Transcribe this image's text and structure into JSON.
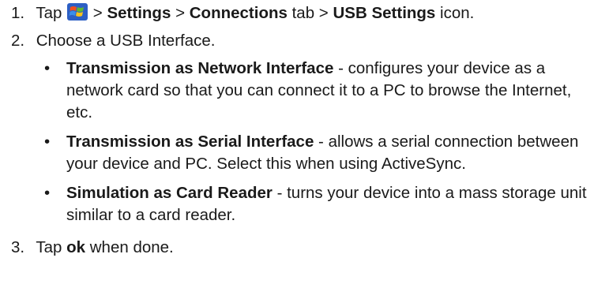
{
  "steps": [
    {
      "number": "1.",
      "text_tap": "Tap",
      "icon": "windows-start-icon",
      "sep1": ">",
      "settings": "Settings",
      "sep2": ">",
      "connections": "Connections",
      "text_tab": "tab >",
      "usb_settings": "USB Settings",
      "text_icon": "icon."
    },
    {
      "number": "2.",
      "text": "Choose a USB Interface."
    },
    {
      "number": "3.",
      "text_tap": "Tap",
      "ok": "ok",
      "text_done": "when done."
    }
  ],
  "bullets": [
    {
      "symbol": "•",
      "title": "Transmission as Network Interface",
      "desc": " - configures your device as a network card so that you can connect it to a PC to browse the Internet, etc."
    },
    {
      "symbol": "•",
      "title": "Transmission as Serial Interface",
      "desc": " - allows a serial connection between your device and PC. Select this when using ActiveSync."
    },
    {
      "symbol": "•",
      "title": "Simulation as Card Reader",
      "desc": " - turns your device into a mass storage unit similar to a card reader."
    }
  ]
}
